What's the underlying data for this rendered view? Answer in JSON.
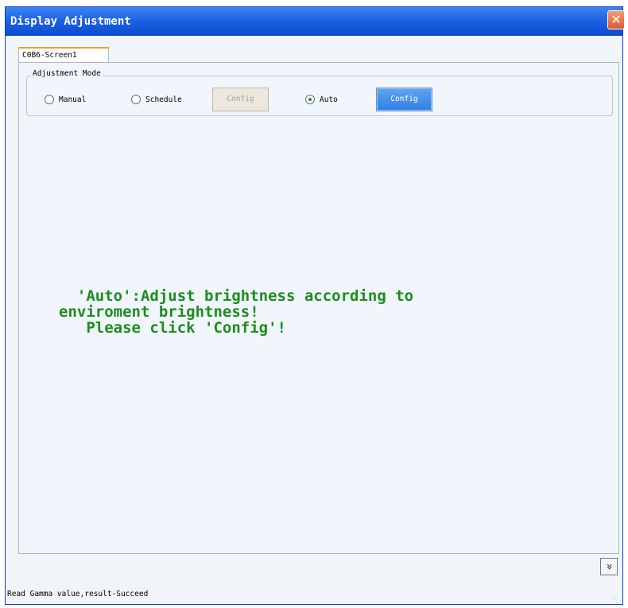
{
  "window": {
    "title": "Display Adjustment",
    "close_symbol": "✕",
    "close_icon": "close-icon"
  },
  "tabs": [
    {
      "label": "C0B6-Screen1",
      "selected": true
    }
  ],
  "adjustment_mode": {
    "legend": "Adjustment Mode",
    "options": [
      {
        "label": "Manual",
        "selected": false
      },
      {
        "label": "Schedule",
        "selected": false
      },
      {
        "label": "Auto",
        "selected": true
      }
    ],
    "schedule_config_label": "Config",
    "auto_config_label": "Config"
  },
  "message": {
    "line1": "  'Auto':Adjust brightness according to",
    "line2": "enviroment brightness!",
    "line3": "   Please click 'Config'!"
  },
  "expand_button": {
    "symbol": "»",
    "icon": "double-chevron-down-icon"
  },
  "status": {
    "text": "Read Gamma value,result-Succeed"
  },
  "colors": {
    "titlebar": "#1f62e4",
    "message": "#1f8c1f",
    "active_button": "#3a87e8",
    "close_button": "#e05a2b"
  }
}
